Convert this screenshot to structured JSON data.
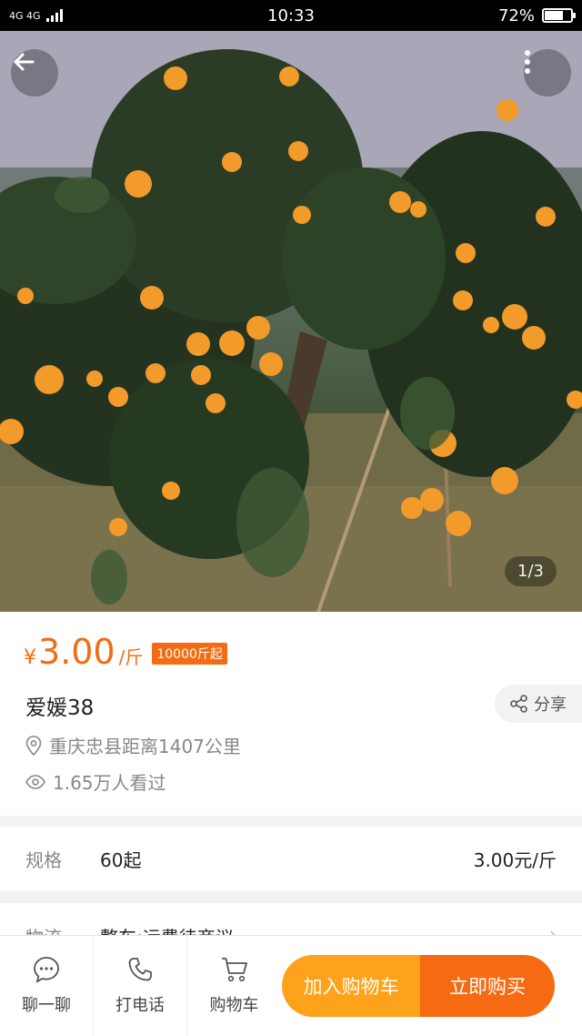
{
  "status_bar": {
    "network": "4G 4G",
    "time": "10:33",
    "battery": "72%",
    "battery_level": 0.72
  },
  "gallery": {
    "page_indicator": "1/3",
    "back_icon": "arrow-left-icon",
    "more_icon": "more-vertical-icon"
  },
  "product": {
    "currency": "¥",
    "price": "3.00",
    "unit": "/斤",
    "min_order": "10000斤起",
    "name": "爱媛38",
    "share_label": "分享",
    "location": "重庆忠县距离1407公里",
    "views": "1.65万人看过"
  },
  "spec": {
    "label": "规格",
    "value": "60起",
    "price": "3.00元/斤"
  },
  "logistics": {
    "label": "物流",
    "value": "整车;运费待商议"
  },
  "bottom_bar": {
    "chat_label": "聊一聊",
    "call_label": "打电话",
    "cart_label": "购物车",
    "add_cart_label": "加入购物车",
    "buy_now_label": "立即购买"
  },
  "colors": {
    "accent": "#f36c14",
    "cart_button": "#fda21a",
    "buy_button": "#f56a12"
  }
}
